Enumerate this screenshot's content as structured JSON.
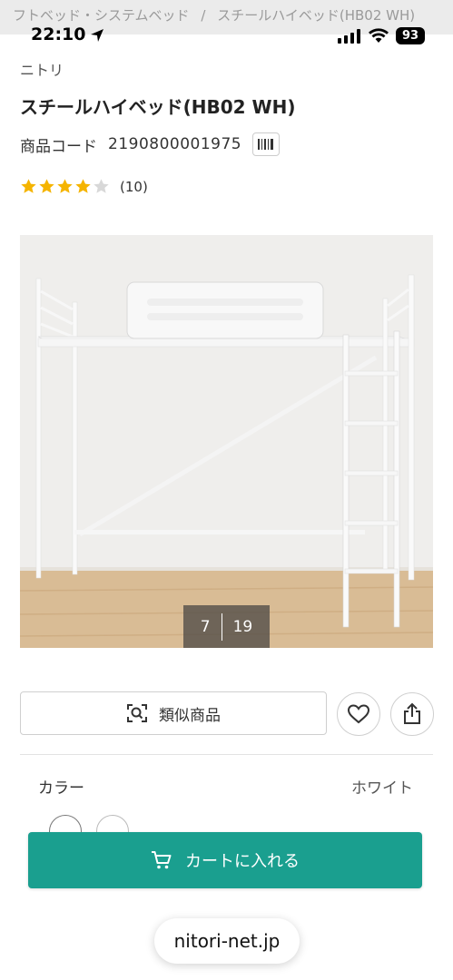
{
  "breadcrumb": {
    "parent": "フトベッド・システムベッド",
    "separator": "/",
    "current": "スチールハイベッド(HB02 WH)"
  },
  "status_bar": {
    "time": "22:10",
    "battery": "93"
  },
  "product": {
    "brand": "ニトリ",
    "title": "スチールハイベッド(HB02 WH)",
    "code_label": "商品コード",
    "code_value": "2190800001975",
    "rating": 4,
    "rating_max": 5,
    "review_count": "(10)"
  },
  "gallery": {
    "current": "7",
    "total": "19"
  },
  "actions": {
    "similar_label": "類似商品",
    "favorite_icon": "heart-icon",
    "share_icon": "share-icon"
  },
  "color": {
    "label": "カラー",
    "value": "ホワイト"
  },
  "cart": {
    "label": "カートに入れる",
    "color": "#1a9f8f"
  },
  "browser": {
    "url": "nitori-net.jp"
  },
  "colors": {
    "accent": "#1a9f8f",
    "star": "#f5b400",
    "star_empty": "#d8d8d8"
  }
}
